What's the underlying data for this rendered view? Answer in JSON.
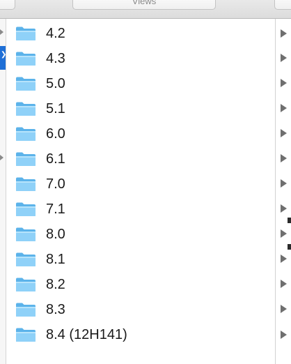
{
  "toolbar": {
    "center_label": "Views"
  },
  "folders": [
    {
      "label": "4.2",
      "icon": "folder-icon"
    },
    {
      "label": "4.3",
      "icon": "folder-icon"
    },
    {
      "label": "5.0",
      "icon": "folder-icon"
    },
    {
      "label": "5.1",
      "icon": "folder-icon"
    },
    {
      "label": "6.0",
      "icon": "folder-icon"
    },
    {
      "label": "6.1",
      "icon": "folder-icon"
    },
    {
      "label": "7.0",
      "icon": "folder-icon"
    },
    {
      "label": "7.1",
      "icon": "folder-icon"
    },
    {
      "label": "8.0",
      "icon": "folder-icon"
    },
    {
      "label": "8.1",
      "icon": "folder-icon"
    },
    {
      "label": "8.2",
      "icon": "folder-icon"
    },
    {
      "label": "8.3",
      "icon": "folder-icon"
    },
    {
      "label": "8.4 (12H141)",
      "icon": "folder-icon"
    }
  ],
  "colors": {
    "folder_light": "#a9dcfa",
    "folder_mid": "#7cc8f4",
    "folder_dark": "#5cb3ea",
    "selection_blue": "#1f6fd6",
    "disclosure_arrow": "#6f6f6f"
  }
}
